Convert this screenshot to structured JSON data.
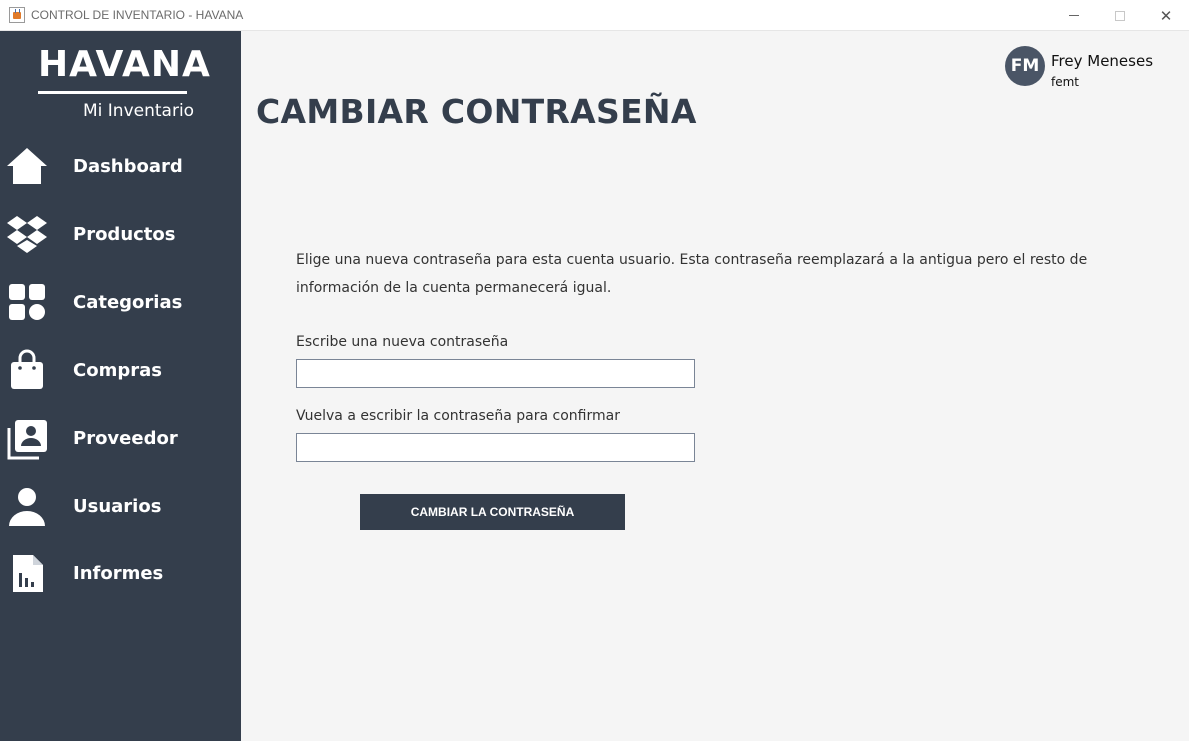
{
  "window": {
    "title": "CONTROL DE INVENTARIO - HAVANA",
    "controls": {
      "minimize": "minimize-icon",
      "maximize": "maximize-icon",
      "close": "✕"
    }
  },
  "sidebar": {
    "brand": "HAVANA",
    "subtitle": "Mi Inventario",
    "items": [
      {
        "label": "Dashboard",
        "icon": "home-icon"
      },
      {
        "label": "Productos",
        "icon": "dropbox-icon"
      },
      {
        "label": "Categorias",
        "icon": "grid-icon"
      },
      {
        "label": "Compras",
        "icon": "shopping-bag-icon"
      },
      {
        "label": "Proveedor",
        "icon": "contacts-icon"
      },
      {
        "label": "Usuarios",
        "icon": "user-icon"
      },
      {
        "label": "Informes",
        "icon": "report-icon"
      }
    ]
  },
  "user": {
    "initials": "FM",
    "name": "Frey Meneses",
    "handle": "femt"
  },
  "main": {
    "title": "CAMBIAR CONTRASEÑA",
    "description": "Elige una nueva contraseña para esta cuenta usuario. Esta contraseña reemplazará a la antigua pero el resto de información de la cuenta permanecerá igual.",
    "new_password_label": "Escribe una nueva contraseña",
    "new_password_value": "",
    "confirm_password_label": "Vuelva a escribir la contraseña para confirmar",
    "confirm_password_value": "",
    "submit_label": "CAMBIAR LA CONTRASEÑA"
  },
  "colors": {
    "sidebar_bg": "#343e4c",
    "content_bg": "#f5f5f5",
    "accent": "#343e4c",
    "avatar_bg": "#4a5566"
  }
}
